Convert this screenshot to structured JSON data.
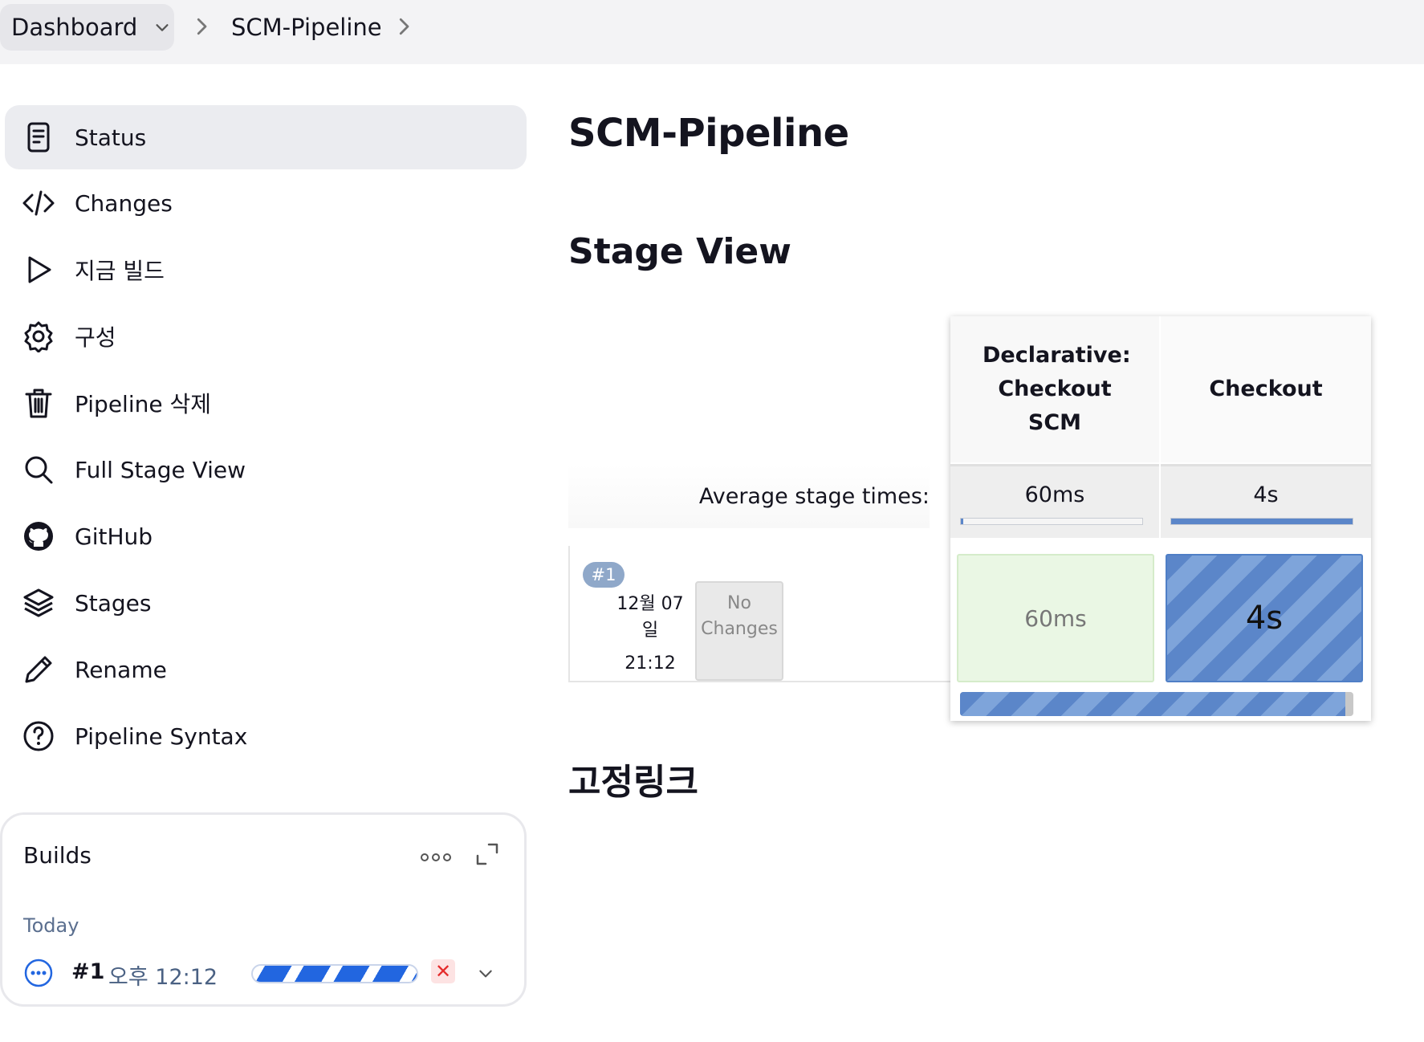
{
  "breadcrumb": {
    "items": [
      "Dashboard",
      "SCM-Pipeline"
    ]
  },
  "sidebar": {
    "items": [
      {
        "label": "Status",
        "icon": "document-icon",
        "active": true
      },
      {
        "label": "Changes",
        "icon": "code-icon"
      },
      {
        "label": "지금 빌드",
        "icon": "play-icon"
      },
      {
        "label": "구성",
        "icon": "gear-icon"
      },
      {
        "label": "Pipeline 삭제",
        "icon": "trash-icon"
      },
      {
        "label": "Full Stage View",
        "icon": "search-icon"
      },
      {
        "label": "GitHub",
        "icon": "github-icon"
      },
      {
        "label": "Stages",
        "icon": "layers-icon"
      },
      {
        "label": "Rename",
        "icon": "pencil-icon"
      },
      {
        "label": "Pipeline Syntax",
        "icon": "help-circle-icon"
      }
    ]
  },
  "builds": {
    "title": "Builds",
    "group": "Today",
    "items": [
      {
        "number": "#1",
        "time": "오후 12:12",
        "status": "in-progress",
        "status_icon": "ellipsis-circle-icon",
        "status_color": "#2266e0"
      }
    ]
  },
  "main": {
    "title": "SCM-Pipeline",
    "stage_view_heading": "Stage View",
    "permalinks_heading": "고정링크"
  },
  "stage_view": {
    "average_label": "Average stage times:",
    "stages": [
      {
        "name": "Declarative: Checkout SCM",
        "average": "60ms",
        "average_fraction": 0.015
      },
      {
        "name": "Checkout",
        "average": "4s",
        "average_fraction": 1.0
      }
    ],
    "runs": [
      {
        "badge": "#1",
        "date": "12월 07 일",
        "time": "21:12",
        "changes": "No Changes",
        "stage_times": [
          "60ms",
          "4s"
        ],
        "stage_states": [
          "success",
          "in-progress"
        ],
        "overall_progress": 0.98
      }
    ],
    "colors": {
      "success": "#eaf7e4",
      "in_progress": "#5b86c9",
      "badge": "#8fa8c9"
    }
  }
}
